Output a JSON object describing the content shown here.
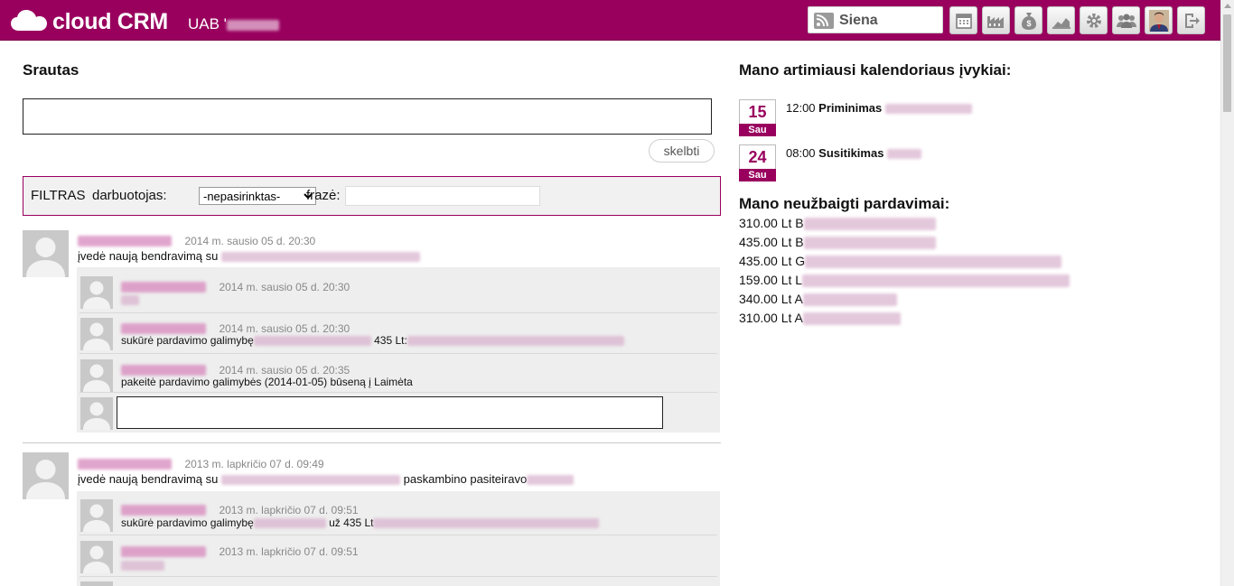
{
  "header": {
    "brand": "cloud CRM",
    "company_prefix": "UAB '",
    "siena_label": "Siena",
    "accent": "#99005e",
    "icons": [
      "calendar-icon",
      "factory-icon",
      "money-bag-icon",
      "chart-icon",
      "gear-icon",
      "users-icon",
      "user-avatar-icon",
      "logout-icon"
    ]
  },
  "stream": {
    "title": "Srautas",
    "post_button": "skelbti"
  },
  "filter": {
    "title": "FILTRAS",
    "employee_label": "darbuotojas:",
    "employee_selected": "-nepasirinktas-",
    "phrase_label": "frazė:"
  },
  "activities": [
    {
      "timestamp": "2014 m. sausio 05 d. 20:30",
      "text_prefix": "įvedė naują bendravimą su",
      "text_suffix": "",
      "comments": [
        {
          "timestamp": "2014 m. sausio 05 d. 20:30",
          "text": ""
        },
        {
          "timestamp": "2014 m. sausio 05 d. 20:30",
          "text_prefix": "sukūrė pardavimo galimybę",
          "text_mid": "435 Lt:"
        },
        {
          "timestamp": "2014 m. sausio 05 d. 20:35",
          "text": "pakeitė pardavimo galimybės (2014-01-05) būseną į Laimėta"
        }
      ]
    },
    {
      "timestamp": "2013 m. lapkričio 07 d. 09:49",
      "text_prefix": "įvedė naują bendravimą su",
      "text_suffix": "paskambino pasiteiravo",
      "comments": [
        {
          "timestamp": "2013 m. lapkričio 07 d. 09:51",
          "text_prefix": "sukūrė pardavimo galimybę",
          "text_mid": "už 435 Lt"
        },
        {
          "timestamp": "2013 m. lapkričio 07 d. 09:51",
          "text": ""
        }
      ]
    }
  ],
  "calendar": {
    "title": "Mano artimiausi kalendoriaus įvykiai:",
    "events": [
      {
        "day": "15",
        "weekday": "Sau",
        "time": "12:00",
        "type": "Priminimas"
      },
      {
        "day": "24",
        "weekday": "Sau",
        "time": "08:00",
        "type": "Susitikimas"
      }
    ]
  },
  "sales": {
    "title": "Mano neužbaigti pardavimai:",
    "items": [
      {
        "amount": "310.00 Lt",
        "initial": "B"
      },
      {
        "amount": "435.00 Lt",
        "initial": "B"
      },
      {
        "amount": "435.00 Lt",
        "initial": "G"
      },
      {
        "amount": "159.00 Lt",
        "initial": "L"
      },
      {
        "amount": "340.00 Lt",
        "initial": "A"
      },
      {
        "amount": "310.00 Lt",
        "initial": "A"
      }
    ]
  }
}
